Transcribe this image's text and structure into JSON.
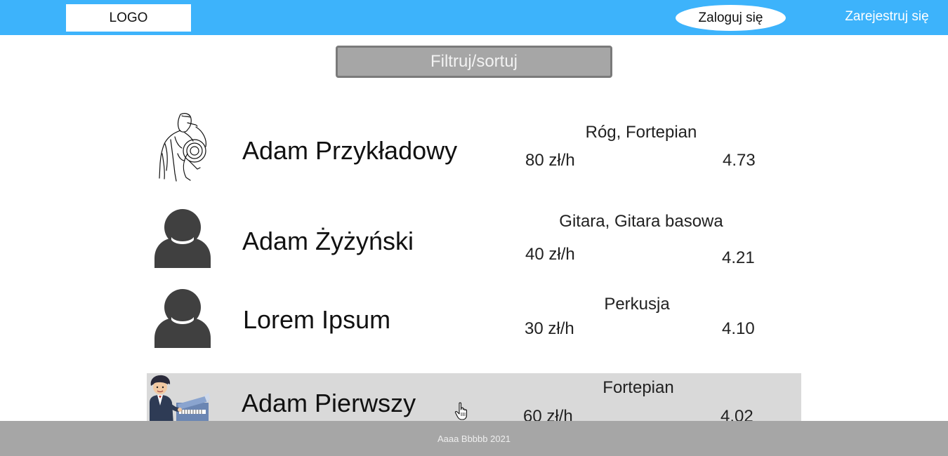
{
  "header": {
    "logo_label": "LOGO",
    "login_label": "Zaloguj się",
    "register_label": "Zarejestruj się",
    "accent_color": "#3db3fb"
  },
  "filter": {
    "label": "Filtruj/sortuj"
  },
  "teachers": [
    {
      "name": "Adam Przykładowy",
      "instruments": "Róg, Fortepian",
      "price": "80 zł/h",
      "rating": "4.73",
      "avatar": "horn-player-drawing"
    },
    {
      "name": "Adam Żyżyński",
      "instruments": "Gitara, Gitara basowa",
      "price": "40 zł/h",
      "rating": "4.21",
      "avatar": "default-user-icon"
    },
    {
      "name": "Lorem Ipsum",
      "instruments": "Perkusja",
      "price": "30 zł/h",
      "rating": "4.10",
      "avatar": "default-user-icon"
    },
    {
      "name": "Adam Pierwszy",
      "instruments": "Fortepian",
      "price": "60 zł/h",
      "rating": "4.02",
      "avatar": "pianist-cartoon"
    }
  ],
  "footer": {
    "text": "Aaaa Bbbbb 2021"
  }
}
